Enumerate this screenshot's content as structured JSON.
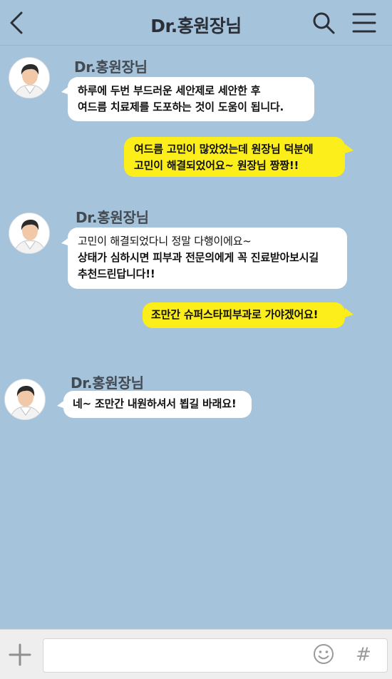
{
  "header": {
    "title": "Dr.홍원장님",
    "back_icon": "chevron-left-icon",
    "search_icon": "search-icon",
    "menu_icon": "hamburger-menu-icon"
  },
  "messages": [
    {
      "direction": "incoming",
      "sender": "Dr.홍원장님",
      "lines": [
        "하루에 두번 부드러운 세안제로 세안한 후",
        "여드름 치료제를 도포하는 것이 도움이 됩니다."
      ]
    },
    {
      "direction": "outgoing",
      "lines": [
        "여드름 고민이 많았었는데 원장님 덕분에",
        "고민이 해결되었어요~  원장님 짱짱!!"
      ]
    },
    {
      "direction": "incoming",
      "sender": "Dr.홍원장님",
      "lines": [
        "고민이 해결되었다니 정말 다행이에요~",
        "상태가 심하시면 피부과 전문의에게 꼭 진료받아보시길",
        "추천드린답니다!!"
      ]
    },
    {
      "direction": "outgoing",
      "lines": [
        "조만간 슈퍼스타피부과로 가야겠어요!"
      ]
    },
    {
      "direction": "incoming",
      "sender": "Dr.홍원장님",
      "lines": [
        "네~ 조만간 내원하셔서 뵙길 바래요!"
      ]
    }
  ],
  "input_bar": {
    "value": "",
    "plus_icon": "plus-icon",
    "emoji_icon": "smiley-icon",
    "hash_icon": "hashtag-icon",
    "hash_glyph": "#"
  },
  "colors": {
    "background": "#a5c3db",
    "incoming_bubble": "#ffffff",
    "outgoing_bubble": "#fcee1a"
  }
}
